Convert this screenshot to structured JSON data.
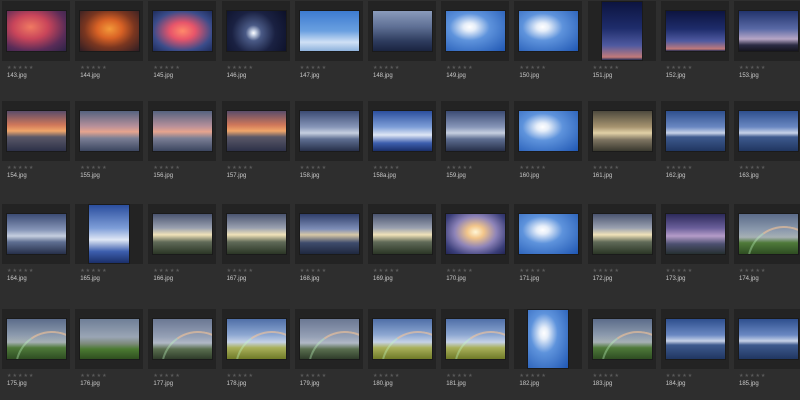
{
  "thumbnails": [
    {
      "filename": "143.jpg",
      "rating": 0,
      "orientation": "landscape",
      "theme": "sunset-red"
    },
    {
      "filename": "144.jpg",
      "rating": 0,
      "orientation": "landscape",
      "theme": "sunset-orange"
    },
    {
      "filename": "145.jpg",
      "rating": 0,
      "orientation": "landscape",
      "theme": "sunset-pink-clouds"
    },
    {
      "filename": "146.jpg",
      "rating": 0,
      "orientation": "landscape",
      "theme": "night-moon"
    },
    {
      "filename": "147.jpg",
      "rating": 0,
      "orientation": "landscape",
      "theme": "blue-clouds-light"
    },
    {
      "filename": "148.jpg",
      "rating": 0,
      "orientation": "landscape",
      "theme": "storm-clouds"
    },
    {
      "filename": "149.jpg",
      "rating": 0,
      "orientation": "landscape",
      "theme": "blue-sky-clouds"
    },
    {
      "filename": "150.jpg",
      "rating": 0,
      "orientation": "landscape",
      "theme": "blue-sky-clouds"
    },
    {
      "filename": "151.jpg",
      "rating": 0,
      "orientation": "portrait",
      "theme": "twilight"
    },
    {
      "filename": "152.jpg",
      "rating": 0,
      "orientation": "landscape",
      "theme": "twilight"
    },
    {
      "filename": "153.jpg",
      "rating": 0,
      "orientation": "landscape",
      "theme": "dusk-tree"
    },
    {
      "filename": "154.jpg",
      "rating": 0,
      "orientation": "landscape",
      "theme": "sunset-sea"
    },
    {
      "filename": "155.jpg",
      "rating": 0,
      "orientation": "landscape",
      "theme": "sunset-sea-pink"
    },
    {
      "filename": "156.jpg",
      "rating": 0,
      "orientation": "landscape",
      "theme": "sunset-sea-pink"
    },
    {
      "filename": "157.jpg",
      "rating": 0,
      "orientation": "landscape",
      "theme": "sunset-sea"
    },
    {
      "filename": "158.jpg",
      "rating": 0,
      "orientation": "landscape",
      "theme": "rays-sea"
    },
    {
      "filename": "158a.jpg",
      "rating": 0,
      "orientation": "landscape",
      "theme": "rays-blue"
    },
    {
      "filename": "159.jpg",
      "rating": 0,
      "orientation": "landscape",
      "theme": "rays-sea"
    },
    {
      "filename": "160.jpg",
      "rating": 0,
      "orientation": "landscape",
      "theme": "blue-sky-clouds"
    },
    {
      "filename": "161.jpg",
      "rating": 0,
      "orientation": "landscape",
      "theme": "rays-gold"
    },
    {
      "filename": "162.jpg",
      "rating": 0,
      "orientation": "landscape",
      "theme": "blue-sea"
    },
    {
      "filename": "163.jpg",
      "rating": 0,
      "orientation": "landscape",
      "theme": "blue-sea"
    },
    {
      "filename": "164.jpg",
      "rating": 0,
      "orientation": "landscape",
      "theme": "rays-sea"
    },
    {
      "filename": "165.jpg",
      "rating": 0,
      "orientation": "portrait",
      "theme": "rays-blue"
    },
    {
      "filename": "166.jpg",
      "rating": 0,
      "orientation": "landscape",
      "theme": "rays-land"
    },
    {
      "filename": "167.jpg",
      "rating": 0,
      "orientation": "landscape",
      "theme": "rays-land"
    },
    {
      "filename": "168.jpg",
      "rating": 0,
      "orientation": "landscape",
      "theme": "rays-mountain"
    },
    {
      "filename": "169.jpg",
      "rating": 0,
      "orientation": "landscape",
      "theme": "rays-land"
    },
    {
      "filename": "170.jpg",
      "rating": 0,
      "orientation": "landscape",
      "theme": "rays-bright"
    },
    {
      "filename": "171.jpg",
      "rating": 0,
      "orientation": "landscape",
      "theme": "blue-sky-clouds"
    },
    {
      "filename": "172.jpg",
      "rating": 0,
      "orientation": "landscape",
      "theme": "rays-land"
    },
    {
      "filename": "173.jpg",
      "rating": 0,
      "orientation": "landscape",
      "theme": "purple-sky"
    },
    {
      "filename": "174.jpg",
      "rating": 0,
      "orientation": "landscape",
      "theme": "rainbow-green"
    },
    {
      "filename": "175.jpg",
      "rating": 0,
      "orientation": "landscape",
      "theme": "rainbow-green"
    },
    {
      "filename": "176.jpg",
      "rating": 0,
      "orientation": "landscape",
      "theme": "grey-green"
    },
    {
      "filename": "177.jpg",
      "rating": 0,
      "orientation": "landscape",
      "theme": "rainbow-grey"
    },
    {
      "filename": "178.jpg",
      "rating": 0,
      "orientation": "landscape",
      "theme": "rainbow-yellow"
    },
    {
      "filename": "179.jpg",
      "rating": 0,
      "orientation": "landscape",
      "theme": "rainbow-grey"
    },
    {
      "filename": "180.jpg",
      "rating": 0,
      "orientation": "landscape",
      "theme": "rainbow-yellow"
    },
    {
      "filename": "181.jpg",
      "rating": 0,
      "orientation": "landscape",
      "theme": "rainbow-yellow"
    },
    {
      "filename": "182.jpg",
      "rating": 0,
      "orientation": "portrait",
      "theme": "blue-sky-clouds"
    },
    {
      "filename": "183.jpg",
      "rating": 0,
      "orientation": "landscape",
      "theme": "rainbow-green"
    },
    {
      "filename": "184.jpg",
      "rating": 0,
      "orientation": "landscape",
      "theme": "blue-sea"
    },
    {
      "filename": "185.jpg",
      "rating": 0,
      "orientation": "landscape",
      "theme": "blue-sea"
    }
  ],
  "rating_glyphs": "★★★★★",
  "colors": {
    "background": "#2e2e2e",
    "tile": "#232323",
    "filename_text": "#c9c9c9",
    "star_empty": "#5a5a5a"
  }
}
